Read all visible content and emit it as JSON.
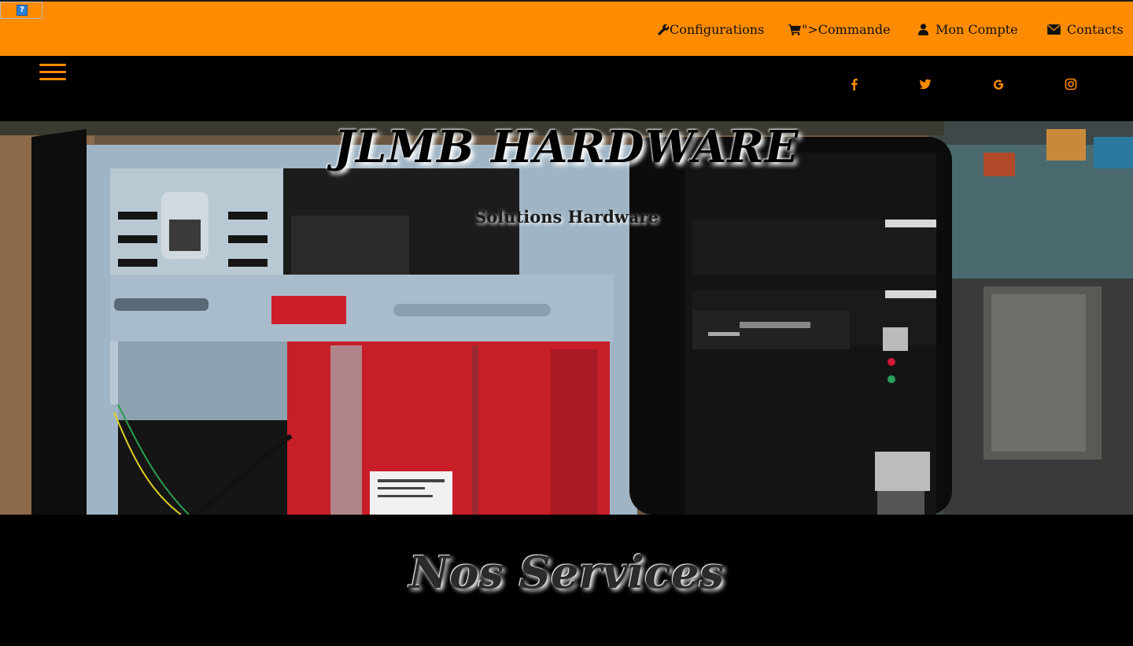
{
  "topbar": {
    "broken_image_glyph": "?",
    "nav": [
      {
        "label": "Configurations",
        "icon": "wrench-icon"
      },
      {
        "label": "\">Commande",
        "icon": "shopping-cart-icon"
      },
      {
        "label": "Mon Compte",
        "icon": "user-icon"
      },
      {
        "label": "Contacts",
        "icon": "envelope-icon"
      }
    ],
    "accent_color": "#ff8c00"
  },
  "subbar": {
    "menu_icon": "hamburger-menu-icon",
    "social": [
      {
        "icon": "facebook-icon"
      },
      {
        "icon": "twitter-icon"
      },
      {
        "icon": "google-icon"
      },
      {
        "icon": "instagram-icon"
      }
    ]
  },
  "hero": {
    "title": "JLMB HARDWARE",
    "subtitle": "Solutions Hardware",
    "image_description": "computer-tower-photo"
  },
  "services": {
    "title": "Nos Services"
  }
}
